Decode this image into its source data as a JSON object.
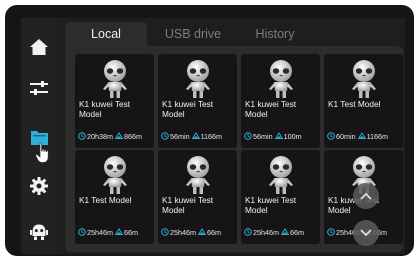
{
  "colors": {
    "accent": "#2eb0d8",
    "background": "#1e1e1e",
    "card": "#151515",
    "panel": "#2c2c2c"
  },
  "sidebar": {
    "items": [
      {
        "icon": "home-icon"
      },
      {
        "icon": "sliders-icon"
      },
      {
        "icon": "folder-icon",
        "active": true
      },
      {
        "icon": "gear-icon"
      },
      {
        "icon": "robot-icon"
      }
    ]
  },
  "tabs": [
    {
      "label": "Local",
      "active": true
    },
    {
      "label": "USB drive",
      "active": false
    },
    {
      "label": "History",
      "active": false
    }
  ],
  "files": [
    {
      "name": "K1 kuwei Test Model",
      "time": "20h38m",
      "filament": "866m"
    },
    {
      "name": "K1 kuwei Test Model",
      "time": "56min",
      "filament": "1166m"
    },
    {
      "name": "K1 kuwei Test Model",
      "time": "56min",
      "filament": "100m"
    },
    {
      "name": "K1 Test Model",
      "time": "60min",
      "filament": "1166m"
    },
    {
      "name": "K1 Test Model",
      "time": "25h46m",
      "filament": "66m"
    },
    {
      "name": "K1 kuwei Test Model",
      "time": "25h46m",
      "filament": "66m"
    },
    {
      "name": "K1 kuwei Test Model",
      "time": "25h46m",
      "filament": "66m"
    },
    {
      "name": "K1 kuwei Test Model",
      "time": "25h46m",
      "filament": "66m"
    }
  ],
  "scroll": {
    "up_icon": "chevron-up-icon",
    "down_icon": "chevron-down-icon"
  }
}
